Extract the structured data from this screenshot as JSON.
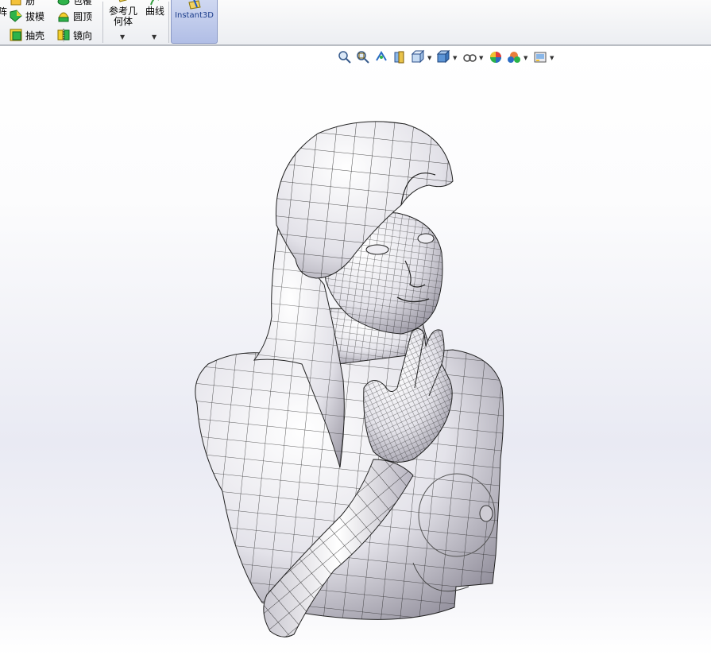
{
  "ribbon": {
    "col1": {
      "item0": "筋",
      "item1": "拔模",
      "item2": "抽壳"
    },
    "col2": {
      "item0": "包覆",
      "item1": "圆顶",
      "item2": "镜向"
    },
    "left_cut": "阵",
    "ref_geometry": {
      "line1": "参考几",
      "line2": "何体"
    },
    "curves": {
      "label": "曲线"
    },
    "instant3d": {
      "label": "Instant3D"
    }
  },
  "heads_up_toolbar": [
    "zoom-to-fit-icon",
    "zoom-to-area-icon",
    "previous-view-icon",
    "section-view-icon",
    "view-orientation-icon",
    "display-style-icon",
    "hide-show-items-icon",
    "edit-appearance-icon",
    "apply-scene-icon",
    "view-settings-icon"
  ],
  "colors": {
    "accent": "#b1bee6",
    "ribbon": "#eceef2",
    "viewport_bottom": "#e9eaf3"
  }
}
